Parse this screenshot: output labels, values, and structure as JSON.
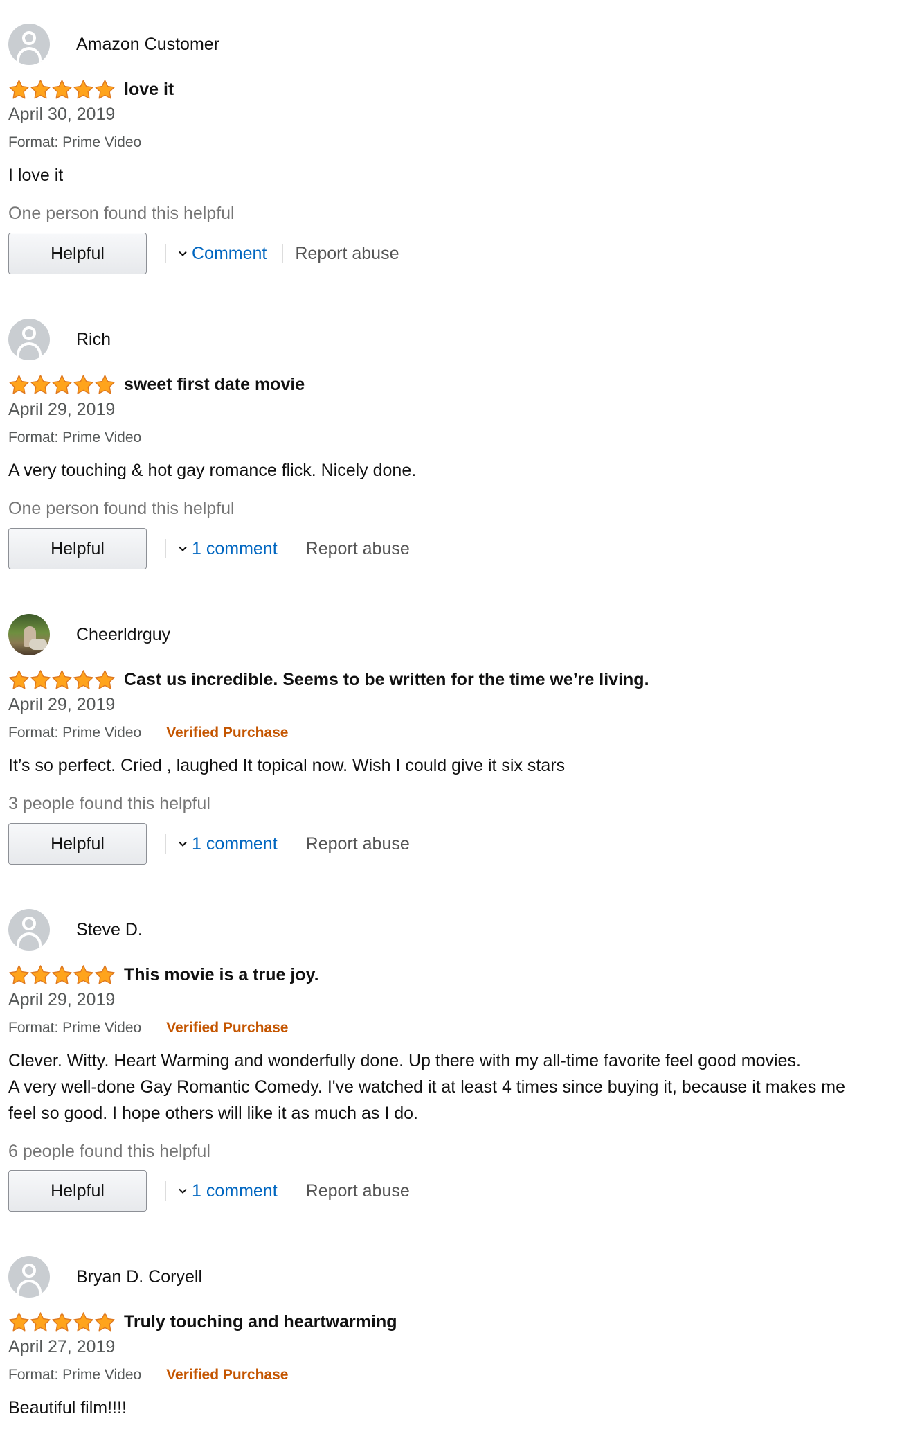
{
  "colors": {
    "star": "#FFA41C",
    "link": "#0066C0",
    "verified": "#C45500",
    "muted": "#565959"
  },
  "reviews": [
    {
      "author": "Amazon Customer",
      "avatar": "default-avatar",
      "rating": 5,
      "title": "love it",
      "date": "April 30, 2019",
      "format": "Format: Prime Video",
      "verified": "",
      "body": [
        "I love it"
      ],
      "helpful_count": "One person found this helpful",
      "helpful_label": "Helpful",
      "comment_label": "Comment",
      "report_label": "Report abuse"
    },
    {
      "author": "Rich",
      "avatar": "default-avatar",
      "rating": 5,
      "title": "sweet first date movie",
      "date": "April 29, 2019",
      "format": "Format: Prime Video",
      "verified": "",
      "body": [
        "A very touching & hot gay romance flick. Nicely done."
      ],
      "helpful_count": "One person found this helpful",
      "helpful_label": "Helpful",
      "comment_label": "1 comment",
      "report_label": "Report abuse"
    },
    {
      "author": "Cheerldrguy",
      "avatar": "photo-avatar",
      "rating": 5,
      "title": "Cast us incredible. Seems to be written for the time we’re living.",
      "date": "April 29, 2019",
      "format": "Format: Prime Video",
      "verified": "Verified Purchase",
      "body": [
        "It’s so perfect. Cried , laughed It topical now. Wish I could give it six stars"
      ],
      "helpful_count": "3 people found this helpful",
      "helpful_label": "Helpful",
      "comment_label": "1 comment",
      "report_label": "Report abuse"
    },
    {
      "author": "Steve D.",
      "avatar": "default-avatar",
      "rating": 5,
      "title": "This movie is a true joy.",
      "date": "April 29, 2019",
      "format": "Format: Prime Video",
      "verified": "Verified Purchase",
      "body": [
        "Clever. Witty. Heart Warming and wonderfully done. Up there with my all-time favorite feel good movies.",
        "A very well-done Gay Romantic Comedy. I've watched it at least 4 times since buying it, because it makes me",
        "feel so good. I hope others will like it as much as I do."
      ],
      "helpful_count": "6 people found this helpful",
      "helpful_label": "Helpful",
      "comment_label": "1 comment",
      "report_label": "Report abuse"
    },
    {
      "author": "Bryan D. Coryell",
      "avatar": "default-avatar",
      "rating": 5,
      "title": "Truly touching and heartwarming",
      "date": "April 27, 2019",
      "format": "Format: Prime Video",
      "verified": "Verified Purchase",
      "body": [
        "Beautiful film!!!!"
      ],
      "helpful_count": "",
      "helpful_label": "",
      "comment_label": "",
      "report_label": ""
    }
  ]
}
